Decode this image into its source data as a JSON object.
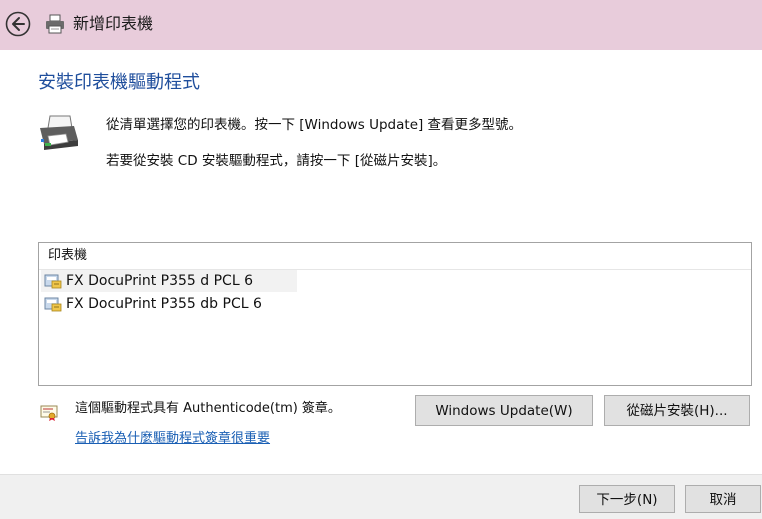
{
  "window": {
    "title": "新增印表機",
    "back_icon": "back-arrow-icon",
    "title_icon": "printer-icon"
  },
  "page": {
    "heading": "安裝印表機驅動程式",
    "heading_color": "#1f4e9c",
    "instruction_line1": "從清單選擇您的印表機。按一下 [Windows Update] 查看更多型號。",
    "instruction_line2": "若要從安裝 CD 安裝驅動程式，請按一下 [從磁片安裝]。"
  },
  "printer_list": {
    "header": "印表機",
    "items": [
      {
        "label": "FX DocuPrint P355 d PCL 6",
        "icon": "printer-driver-icon",
        "selected": true
      },
      {
        "label": "FX DocuPrint P355 db PCL 6",
        "icon": "printer-driver-icon",
        "selected": false
      }
    ]
  },
  "signature": {
    "icon": "certificate-icon",
    "text": "這個驅動程式具有 Authenticode(tm) 簽章。",
    "link": "告訴我為什麼驅動程式簽章很重要"
  },
  "buttons": {
    "windows_update": "Windows Update(W)",
    "have_disk": "從磁片安裝(H)...",
    "next": "下一步(N)",
    "cancel": "取消"
  },
  "colors": {
    "titlebar": "#e8ccdb",
    "link": "#1a5fb4"
  }
}
